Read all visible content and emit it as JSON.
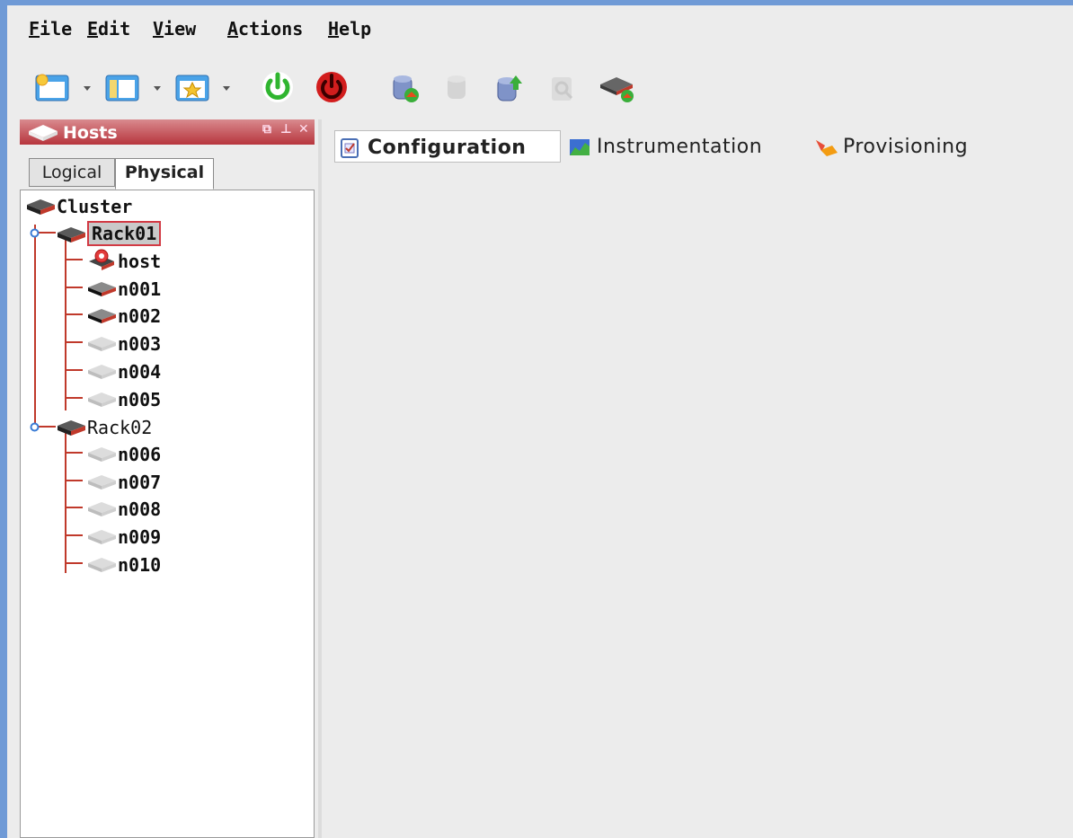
{
  "menu": {
    "items": [
      {
        "label": "File"
      },
      {
        "label": "Edit"
      },
      {
        "label": "View"
      },
      {
        "label": "Actions"
      },
      {
        "label": "Help"
      }
    ]
  },
  "toolbar": {
    "buttons": [
      {
        "icon": "new-window-icon"
      },
      {
        "icon": "layout-panel-icon"
      },
      {
        "icon": "favorites-star-icon"
      },
      {
        "icon": "power-on-icon"
      },
      {
        "icon": "power-off-icon"
      },
      {
        "icon": "database-sync-icon"
      },
      {
        "icon": "database-icon-disabled"
      },
      {
        "icon": "database-upload-icon"
      },
      {
        "icon": "inspect-icon-disabled"
      },
      {
        "icon": "node-provision-icon"
      }
    ]
  },
  "hosts_panel": {
    "title": "Hosts",
    "tabs": [
      {
        "label": "Logical",
        "active": false
      },
      {
        "label": "Physical",
        "active": true
      }
    ],
    "tree": {
      "root": "Cluster",
      "racks": [
        {
          "name": "Rack01",
          "selected": true,
          "children": [
            "host",
            "n001",
            "n002",
            "n003",
            "n004",
            "n005"
          ]
        },
        {
          "name": "Rack02",
          "selected": false,
          "children": [
            "n006",
            "n007",
            "n008",
            "n009",
            "n010"
          ]
        }
      ]
    }
  },
  "main": {
    "tabs": [
      {
        "label": "Configuration",
        "active": true,
        "icon": "checklist-icon"
      },
      {
        "label": "Instrumentation",
        "active": false,
        "icon": "chart-icon"
      },
      {
        "label": "Provisioning",
        "active": false,
        "icon": "provisioning-icon"
      }
    ]
  },
  "colors": {
    "accent": "#c0392b",
    "header_gradient_top": "#d98a8e",
    "header_gradient_bottom": "#b7353d"
  }
}
